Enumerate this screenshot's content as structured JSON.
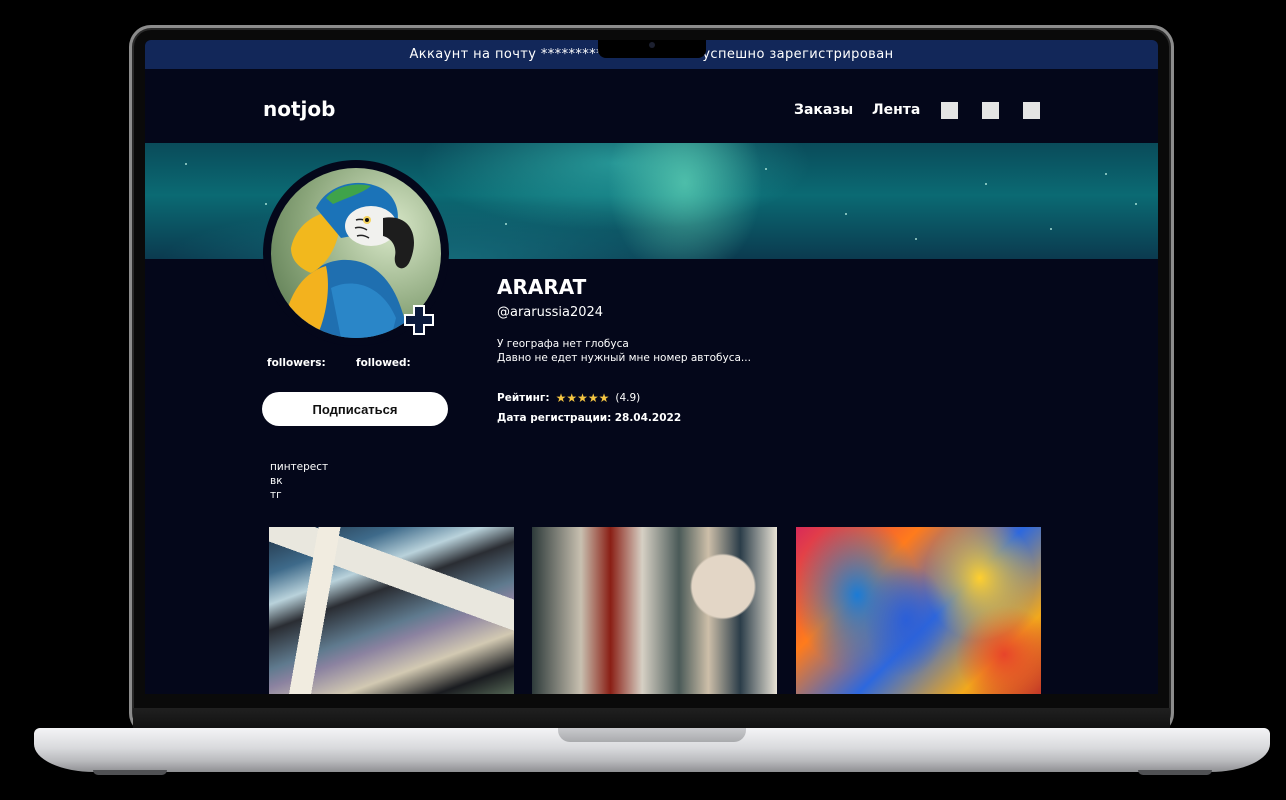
{
  "banner": {
    "text": "Аккаунт на почту ********************.ru успешно зарегистрирован"
  },
  "nav": {
    "logo": "notjob",
    "links": [
      "Заказы",
      "Лента"
    ],
    "icons": [
      "nav-icon-1",
      "nav-icon-2",
      "nav-icon-3"
    ]
  },
  "profile": {
    "name": "ARARAT",
    "handle": "@ararussia2024",
    "bio": [
      "У географа нет глобуса",
      "Давно не едет нужный мне номер автобуса..."
    ],
    "rating_label": "Рейтинг:",
    "rating_stars": "★★★★★",
    "rating_value": "(4.9)",
    "reg_label": "Дата регистрации:",
    "reg_date": "28.04.2022",
    "followers_label": "followers:",
    "followed_label": "followed:",
    "subscribe_label": "Подписаться",
    "socials": [
      "пинтерест",
      "вк",
      "тг"
    ],
    "rating_fraction": 0.98
  },
  "gallery": {
    "count": 3
  },
  "colors": {
    "banner_bg": "#122759",
    "page_bg": "#04071a",
    "star": "#f4c542",
    "button_bg": "#ffffff"
  }
}
